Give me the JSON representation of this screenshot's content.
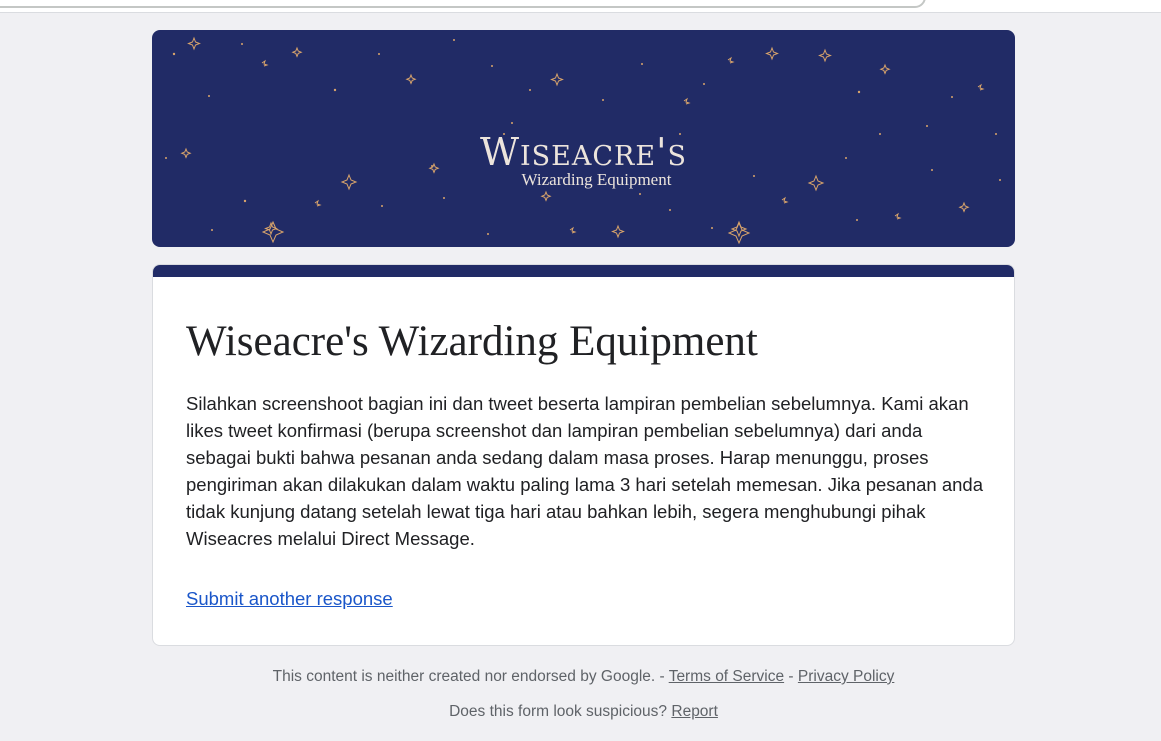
{
  "banner": {
    "brand": "Wiseacre's",
    "subtitle": "Wizarding Equipment",
    "background_color": "#212b66",
    "star_color": "#d9a46b"
  },
  "form": {
    "title": "Wiseacre's Wizarding Equipment",
    "confirmation_message": "Silahkan screenshoot bagian ini dan tweet beserta lampiran pembelian sebelumnya. Kami akan likes tweet konfirmasi (berupa screenshot dan lampiran pembelian sebelumnya) dari anda sebagai bukti bahwa pesanan anda sedang dalam masa proses. Harap menunggu, proses pengiriman akan dilakukan dalam waktu paling lama 3 hari setelah memesan. Jika pesanan anda tidak kunjung datang setelah lewat tiga hari atau bahkan lebih, segera menghubungi pihak Wiseacres melalui Direct Message.",
    "submit_another_link": "Submit another response",
    "accent_color": "#212b66",
    "link_color": "#1a56c9"
  },
  "footer": {
    "disclaimer": "This content is neither created nor endorsed by Google.",
    "sep1": " - ",
    "terms_link": "Terms of Service",
    "sep2": " - ",
    "privacy_link": "Privacy Policy",
    "suspicious_text": "Does this form look suspicious?",
    "report_link": "Report"
  }
}
